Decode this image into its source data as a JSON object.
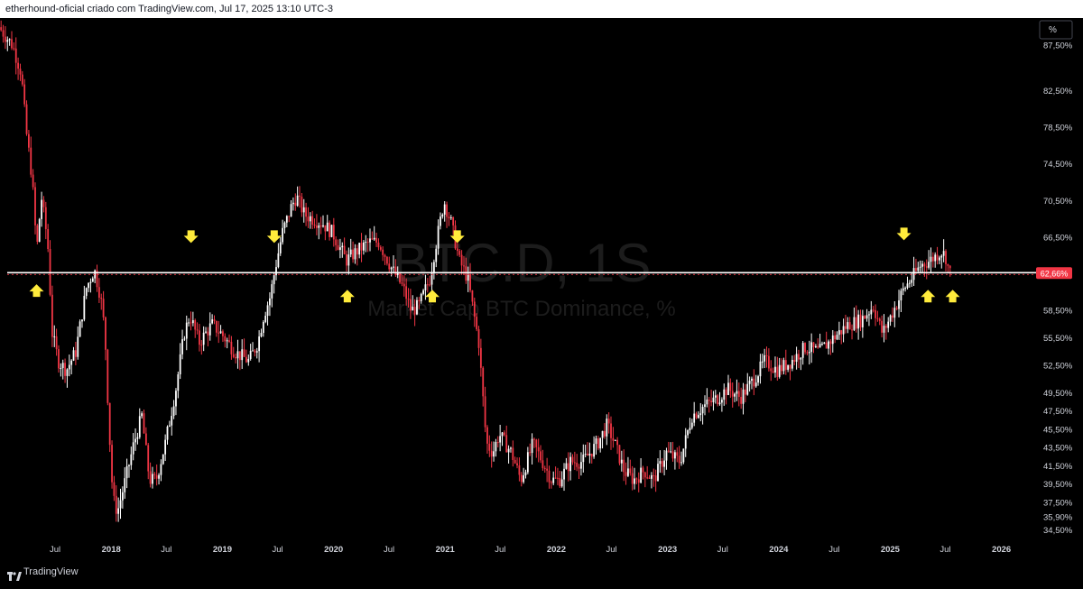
{
  "header": {
    "title": "etherhound-oficial criado com TradingView.com, Jul 17, 2025 13:10 UTC-3"
  },
  "footer": {
    "brand": "TradingView"
  },
  "scale_button": "%",
  "watermark": {
    "symbol": "BTC.D, 1S",
    "description": "Market Cap BTC Dominance, %"
  },
  "colors": {
    "up": "#ffffff",
    "down": "#f23645",
    "line": "#ffffff",
    "price_tag": "#f23645",
    "arrow": "#ffeb3b",
    "background": "#000000"
  },
  "chart_data": {
    "type": "candlestick",
    "title": "BTC.D, 1S",
    "subtitle": "Market Cap BTC Dominance, %",
    "ylim": [
      33.5,
      90.5
    ],
    "y_ticks": [
      "87,50%",
      "82,50%",
      "78,50%",
      "74,50%",
      "70,50%",
      "66,50%",
      "58,50%",
      "55,50%",
      "52,50%",
      "49,50%",
      "47,50%",
      "45,50%",
      "43,50%",
      "41,50%",
      "39,50%",
      "37,50%",
      "35,90%",
      "34,50%"
    ],
    "y_tick_values": [
      87.5,
      82.5,
      78.5,
      74.5,
      70.5,
      66.5,
      58.5,
      55.5,
      52.5,
      49.5,
      47.5,
      45.5,
      43.5,
      41.5,
      39.5,
      37.5,
      35.9,
      34.5
    ],
    "x_ticks": [
      "Jul",
      "2018",
      "Jul",
      "2019",
      "Jul",
      "2020",
      "Jul",
      "2021",
      "Jul",
      "2022",
      "Jul",
      "2023",
      "Jul",
      "2024",
      "Jul",
      "2025",
      "Jul",
      "2026"
    ],
    "x_tick_dates": [
      "2017-07-01",
      "2018-01-01",
      "2018-07-01",
      "2019-01-01",
      "2019-07-01",
      "2020-01-01",
      "2020-07-01",
      "2021-01-01",
      "2021-07-01",
      "2022-01-01",
      "2022-07-01",
      "2023-01-01",
      "2023-07-01",
      "2024-01-01",
      "2024-07-01",
      "2025-01-01",
      "2025-07-01",
      "2026-01-01"
    ],
    "xlim": [
      "2017-01-01",
      "2026-04-01"
    ],
    "horizontal_line": {
      "value": 62.66,
      "label": "62,66%"
    },
    "price_path": [
      [
        "2017-01-01",
        89.5
      ],
      [
        "2017-02-15",
        87.5
      ],
      [
        "2017-03-15",
        84.5
      ],
      [
        "2017-04-01",
        78
      ],
      [
        "2017-04-20",
        73
      ],
      [
        "2017-05-05",
        65
      ],
      [
        "2017-05-20",
        71
      ],
      [
        "2017-06-10",
        66
      ],
      [
        "2017-06-25",
        56
      ],
      [
        "2017-07-15",
        53
      ],
      [
        "2017-08-10",
        52
      ],
      [
        "2017-09-10",
        54
      ],
      [
        "2017-10-15",
        61
      ],
      [
        "2017-11-10",
        63
      ],
      [
        "2017-12-01",
        60
      ],
      [
        "2017-12-15",
        56
      ],
      [
        "2017-12-28",
        46
      ],
      [
        "2018-01-10",
        38
      ],
      [
        "2018-01-25",
        36.5
      ],
      [
        "2018-02-20",
        40
      ],
      [
        "2018-03-20",
        44
      ],
      [
        "2018-04-15",
        47
      ],
      [
        "2018-05-10",
        40
      ],
      [
        "2018-06-01",
        40
      ],
      [
        "2018-07-01",
        44
      ],
      [
        "2018-08-05",
        50
      ],
      [
        "2018-09-01",
        56
      ],
      [
        "2018-09-20",
        58
      ],
      [
        "2018-10-20",
        55
      ],
      [
        "2018-12-01",
        57
      ],
      [
        "2019-01-01",
        56
      ],
      [
        "2019-02-15",
        54
      ],
      [
        "2019-04-01",
        53
      ],
      [
        "2019-05-01",
        55
      ],
      [
        "2019-05-20",
        58
      ],
      [
        "2019-06-10",
        60
      ],
      [
        "2019-06-26",
        63
      ],
      [
        "2019-07-20",
        67
      ],
      [
        "2019-08-20",
        70
      ],
      [
        "2019-09-05",
        71
      ],
      [
        "2019-10-01",
        69
      ],
      [
        "2019-12-01",
        68
      ],
      [
        "2020-01-01",
        67
      ],
      [
        "2020-02-15",
        64
      ],
      [
        "2020-03-20",
        65
      ],
      [
        "2020-05-01",
        66
      ],
      [
        "2020-06-01",
        66
      ],
      [
        "2020-07-15",
        63
      ],
      [
        "2020-08-20",
        61
      ],
      [
        "2020-09-15",
        58.5
      ],
      [
        "2020-10-10",
        59
      ],
      [
        "2020-11-15",
        62
      ],
      [
        "2020-12-01",
        65
      ],
      [
        "2021-01-01",
        70.5
      ],
      [
        "2021-01-25",
        68
      ],
      [
        "2021-02-20",
        64
      ],
      [
        "2021-03-20",
        62
      ],
      [
        "2021-04-25",
        55
      ],
      [
        "2021-05-20",
        44
      ],
      [
        "2021-06-10",
        43
      ],
      [
        "2021-07-01",
        45
      ],
      [
        "2021-08-10",
        43
      ],
      [
        "2021-09-10",
        40
      ],
      [
        "2021-10-20",
        44
      ],
      [
        "2021-11-20",
        42
      ],
      [
        "2021-12-20",
        40
      ],
      [
        "2022-01-15",
        40
      ],
      [
        "2022-02-20",
        42
      ],
      [
        "2022-04-01",
        42
      ],
      [
        "2022-05-20",
        44
      ],
      [
        "2022-06-20",
        46
      ],
      [
        "2022-07-15",
        44
      ],
      [
        "2022-08-15",
        41
      ],
      [
        "2022-09-15",
        40
      ],
      [
        "2022-10-20",
        41
      ],
      [
        "2022-11-20",
        40
      ],
      [
        "2023-01-01",
        43
      ],
      [
        "2023-02-15",
        42
      ],
      [
        "2023-03-25",
        47
      ],
      [
        "2023-05-01",
        48
      ],
      [
        "2023-06-20",
        49
      ],
      [
        "2023-07-20",
        50
      ],
      [
        "2023-09-01",
        49
      ],
      [
        "2023-10-15",
        51
      ],
      [
        "2023-11-20",
        53
      ],
      [
        "2024-01-01",
        52
      ],
      [
        "2024-02-15",
        53
      ],
      [
        "2024-04-01",
        54.5
      ],
      [
        "2024-05-15",
        54
      ],
      [
        "2024-07-01",
        55.5
      ],
      [
        "2024-08-20",
        57
      ],
      [
        "2024-10-01",
        57.5
      ],
      [
        "2024-11-10",
        59
      ],
      [
        "2024-12-10",
        56
      ],
      [
        "2025-01-15",
        58.5
      ],
      [
        "2025-02-20",
        61
      ],
      [
        "2025-03-15",
        62
      ],
      [
        "2025-04-15",
        63.5
      ],
      [
        "2025-05-15",
        64
      ],
      [
        "2025-06-20",
        65
      ],
      [
        "2025-07-05",
        64.5
      ],
      [
        "2025-07-17",
        62.66
      ]
    ],
    "annotations": [
      {
        "type": "arrow-up",
        "date": "2017-05-01",
        "value": 60.8
      },
      {
        "type": "arrow-down",
        "date": "2018-09-20",
        "value": 66.5
      },
      {
        "type": "arrow-down",
        "date": "2019-06-20",
        "value": 66.5
      },
      {
        "type": "arrow-up",
        "date": "2020-02-15",
        "value": 60.2
      },
      {
        "type": "arrow-up",
        "date": "2020-11-20",
        "value": 60.2
      },
      {
        "type": "arrow-down",
        "date": "2021-02-10",
        "value": 66.5
      },
      {
        "type": "arrow-down",
        "date": "2025-02-15",
        "value": 66.8
      },
      {
        "type": "arrow-up",
        "date": "2025-05-05",
        "value": 60.2
      },
      {
        "type": "arrow-up",
        "date": "2025-07-25",
        "value": 60.2
      }
    ]
  }
}
